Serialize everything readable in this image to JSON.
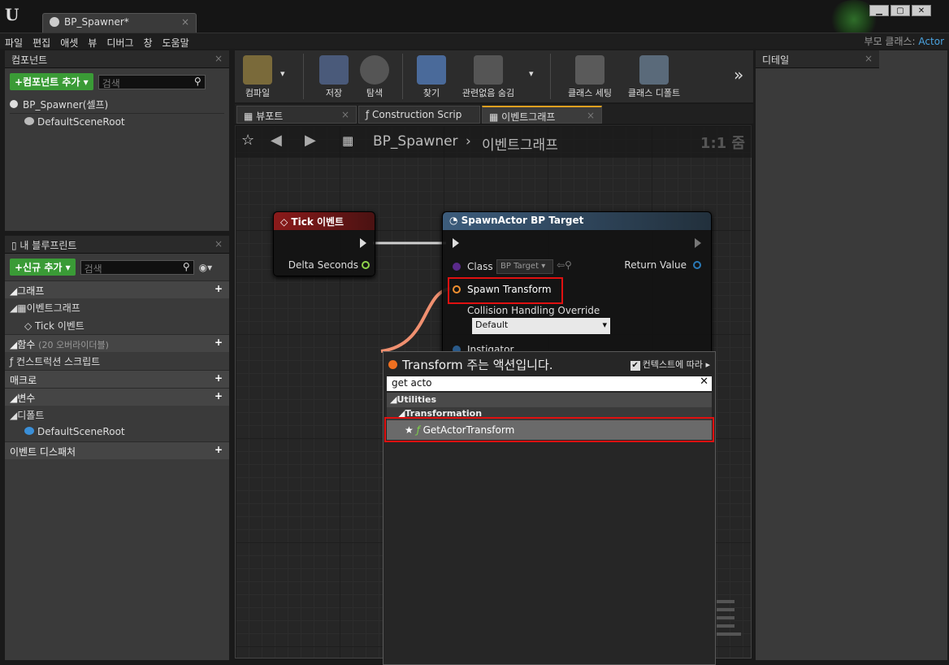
{
  "window": {
    "tab_title": "BP_Spawner*",
    "parent_class_label": "부모 클래스:",
    "parent_class_value": "Actor"
  },
  "menu": [
    "파일",
    "편집",
    "애셋",
    "뷰",
    "디버그",
    "창",
    "도움말"
  ],
  "components": {
    "panel_title": "컴포넌트",
    "add_button": "+컴포넌트 추가",
    "search_placeholder": "검색",
    "self_item": "BP_Spawner(셀프)",
    "root_item": "DefaultSceneRoot"
  },
  "my_blueprint": {
    "panel_title": "내 블루프린트",
    "add_new": "+신규 추가",
    "search_placeholder": "검색",
    "graphs_label": "그래프",
    "event_graph": "이벤트그래프",
    "tick_event": "Tick 이벤트",
    "functions_label": "함수",
    "functions_overrides": "(20 오버라이더블)",
    "construction_script": "컨스트럭션 스크립트",
    "macros_label": "매크로",
    "variables_label": "변수",
    "defaults_label": "디폴트",
    "default_root": "DefaultSceneRoot",
    "event_dispatchers_label": "이벤트 디스패처"
  },
  "toolbar": {
    "compile": "컴파일",
    "save": "저장",
    "browse": "탐색",
    "find": "찾기",
    "hide_unrelated": "관련없음 숨김",
    "class_settings": "클래스 세팅",
    "class_defaults": "클래스 디폴트"
  },
  "graph_tabs": {
    "viewport": "뷰포트",
    "construction": "Construction Scrip",
    "event_graph": "이벤트그래프"
  },
  "breadcrumb": {
    "blueprint": "BP_Spawner",
    "graph": "이벤트그래프",
    "zoom": "1:1 줌"
  },
  "tick_node": {
    "title": "Tick 이벤트",
    "delta": "Delta Seconds"
  },
  "spawn_node": {
    "title": "SpawnActor BP Target",
    "class_label": "Class",
    "class_value": "BP Target",
    "return_value": "Return Value",
    "spawn_transform": "Spawn Transform",
    "collision_label": "Collision Handling Override",
    "collision_value": "Default",
    "instigator": "Instigator"
  },
  "context_menu": {
    "title": "Transform 주는 액션입니다.",
    "context_sensitive": "컨텍스트에 따라",
    "search_value": "get acto",
    "category": "Utilities",
    "subcategory": "Transformation",
    "result": "GetActorTransform"
  },
  "details": {
    "panel_title": "디테일"
  },
  "colors": {
    "accent_green": "#3a9b36",
    "event_red": "#8b1a1a",
    "function_blue": "#3c5c7c",
    "highlight_red": "#e01010",
    "link_blue": "#4aa3e0"
  }
}
